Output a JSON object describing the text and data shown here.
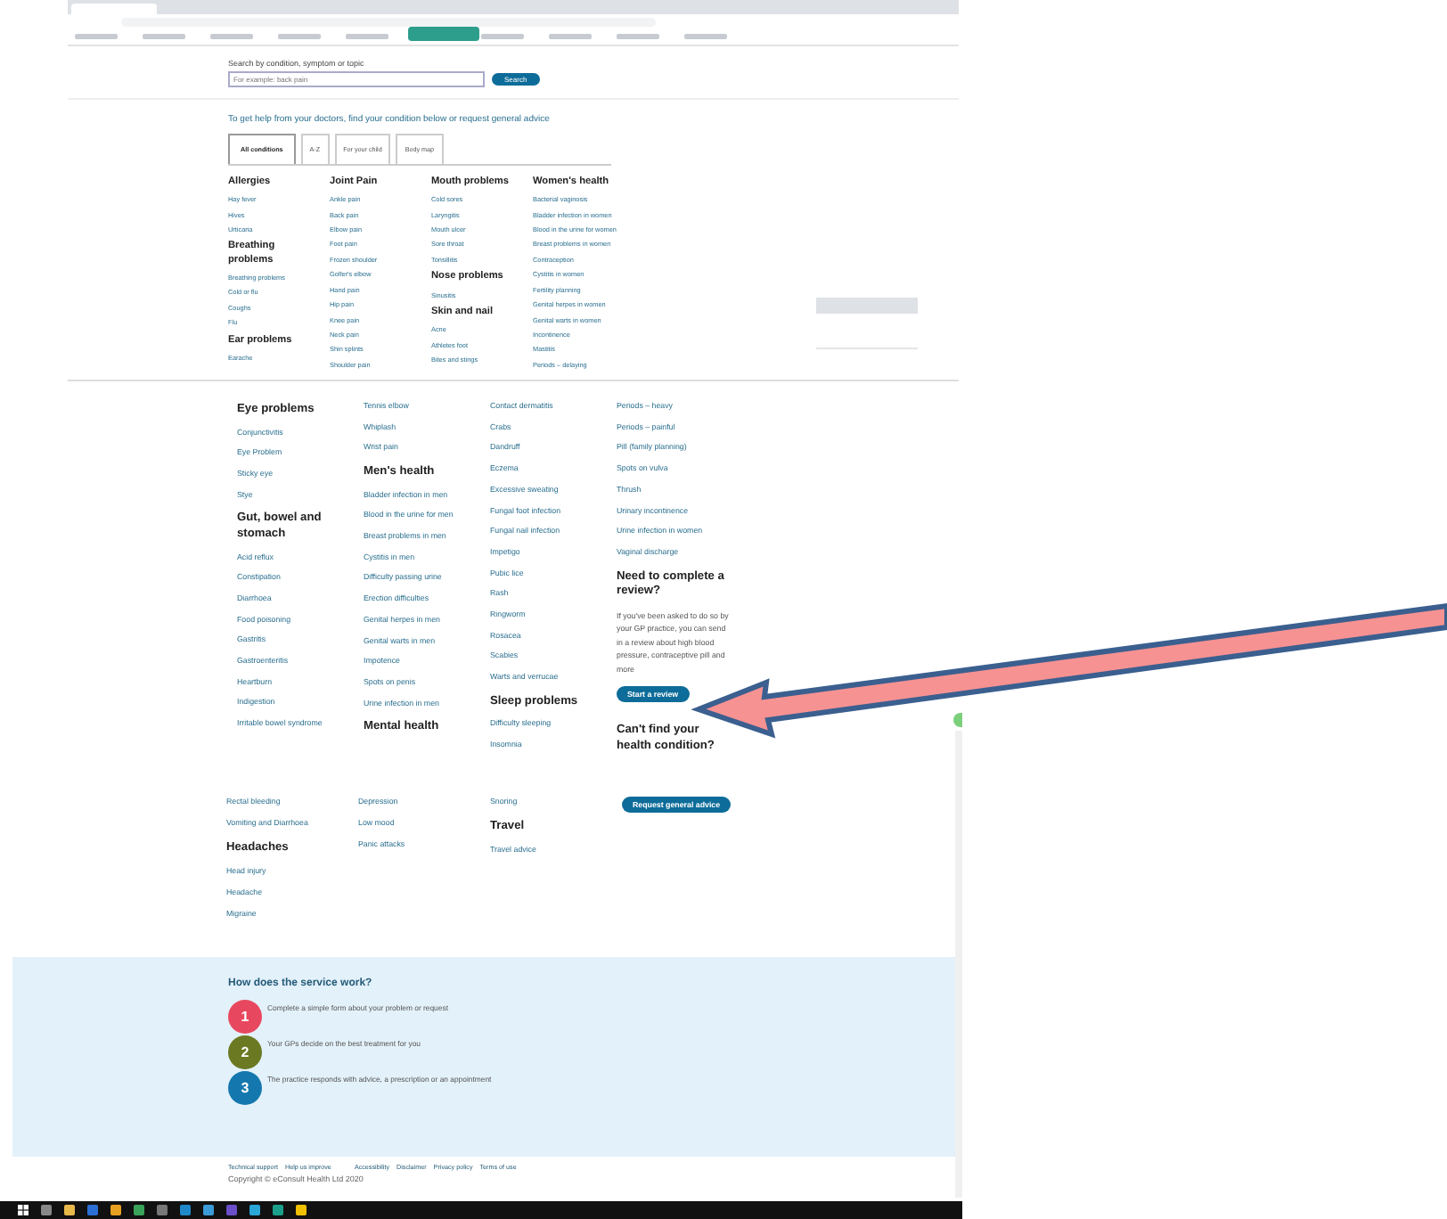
{
  "search": {
    "label": "Search by condition, symptom or topic",
    "placeholder": "For example: back pain",
    "button": "Search"
  },
  "intro": "To get help from your doctors, find your condition below or request general advice",
  "tabs": [
    {
      "label": "All conditions",
      "selected": true
    },
    {
      "label": "A-Z",
      "selected": false
    },
    {
      "label": "For your child",
      "selected": false
    },
    {
      "label": "Body map",
      "selected": false
    }
  ],
  "sections": [
    {
      "columns": [
        [
          {
            "kind": "heading",
            "text": "Allergies"
          },
          {
            "kind": "link",
            "text": "Hay fever"
          },
          {
            "kind": "link",
            "text": "Hives"
          },
          {
            "kind": "link",
            "text": "Urticaria"
          },
          {
            "kind": "heading",
            "text": "Breathing problems"
          },
          {
            "kind": "link",
            "text": "Breathing problems"
          },
          {
            "kind": "link",
            "text": "Cold or flu"
          },
          {
            "kind": "link",
            "text": "Coughs"
          },
          {
            "kind": "link",
            "text": "Flu"
          },
          {
            "kind": "heading",
            "text": "Ear problems"
          },
          {
            "kind": "link",
            "text": "Earache"
          }
        ],
        [
          {
            "kind": "heading",
            "text": "Joint Pain"
          },
          {
            "kind": "link",
            "text": "Ankle pain"
          },
          {
            "kind": "link",
            "text": "Back pain"
          },
          {
            "kind": "link",
            "text": "Elbow pain"
          },
          {
            "kind": "link",
            "text": "Foot pain"
          },
          {
            "kind": "link",
            "text": "Frozen shoulder"
          },
          {
            "kind": "link",
            "text": "Golfer's elbow"
          },
          {
            "kind": "link",
            "text": "Hand pain"
          },
          {
            "kind": "link",
            "text": "Hip pain"
          },
          {
            "kind": "link",
            "text": "Knee pain"
          },
          {
            "kind": "link",
            "text": "Neck pain"
          },
          {
            "kind": "link",
            "text": "Shin splints"
          },
          {
            "kind": "link",
            "text": "Shoulder pain"
          }
        ],
        [
          {
            "kind": "heading",
            "text": "Mouth problems"
          },
          {
            "kind": "link",
            "text": "Cold sores"
          },
          {
            "kind": "link",
            "text": "Laryngitis"
          },
          {
            "kind": "link",
            "text": "Mouth ulcer"
          },
          {
            "kind": "link",
            "text": "Sore throat"
          },
          {
            "kind": "link",
            "text": "Tonsillitis"
          },
          {
            "kind": "heading",
            "text": "Nose problems"
          },
          {
            "kind": "link",
            "text": "Sinusitis"
          },
          {
            "kind": "heading",
            "text": "Skin and nail"
          },
          {
            "kind": "link",
            "text": "Acne"
          },
          {
            "kind": "link",
            "text": "Athletes foot"
          },
          {
            "kind": "link",
            "text": "Bites and stings"
          }
        ],
        [
          {
            "kind": "heading",
            "text": "Women's health"
          },
          {
            "kind": "link",
            "text": "Bacterial vaginosis"
          },
          {
            "kind": "link",
            "text": "Bladder infection in women"
          },
          {
            "kind": "link",
            "text": "Blood in the urine for women"
          },
          {
            "kind": "link",
            "text": "Breast problems in women"
          },
          {
            "kind": "link",
            "text": "Contraception"
          },
          {
            "kind": "link",
            "text": "Cystitis in women"
          },
          {
            "kind": "link",
            "text": "Fertility planning"
          },
          {
            "kind": "link",
            "text": "Genital herpes in women"
          },
          {
            "kind": "link",
            "text": "Genital warts in women"
          },
          {
            "kind": "link",
            "text": "Incontinence"
          },
          {
            "kind": "link",
            "text": "Mastitis"
          },
          {
            "kind": "link",
            "text": "Periods – delaying"
          }
        ]
      ]
    },
    {
      "columns": [
        [
          {
            "kind": "heading",
            "text": "Eye problems"
          },
          {
            "kind": "link",
            "text": "Conjunctivitis"
          },
          {
            "kind": "link",
            "text": "Eye Problem"
          },
          {
            "kind": "link",
            "text": "Sticky eye"
          },
          {
            "kind": "link",
            "text": "Stye"
          },
          {
            "kind": "heading",
            "text": "Gut, bowel and stomach"
          },
          {
            "kind": "link",
            "text": "Acid reflux"
          },
          {
            "kind": "link",
            "text": "Constipation"
          },
          {
            "kind": "link",
            "text": "Diarrhoea"
          },
          {
            "kind": "link",
            "text": "Food poisoning"
          },
          {
            "kind": "link",
            "text": "Gastritis"
          },
          {
            "kind": "link",
            "text": "Gastroenteritis"
          },
          {
            "kind": "link",
            "text": "Heartburn"
          },
          {
            "kind": "link",
            "text": "Indigestion"
          },
          {
            "kind": "link",
            "text": "Irritable bowel syndrome"
          }
        ],
        [
          {
            "kind": "link",
            "text": "Tennis elbow"
          },
          {
            "kind": "link",
            "text": "Whiplash"
          },
          {
            "kind": "link",
            "text": "Wrist pain"
          },
          {
            "kind": "heading",
            "text": "Men's health"
          },
          {
            "kind": "link",
            "text": "Bladder infection in men"
          },
          {
            "kind": "link",
            "text": "Blood in the urine for men"
          },
          {
            "kind": "link",
            "text": "Breast problems in men"
          },
          {
            "kind": "link",
            "text": "Cystitis in men"
          },
          {
            "kind": "link",
            "text": "Difficulty passing urine"
          },
          {
            "kind": "link",
            "text": "Erection difficulties"
          },
          {
            "kind": "link",
            "text": "Genital herpes in men"
          },
          {
            "kind": "link",
            "text": "Genital warts in men"
          },
          {
            "kind": "link",
            "text": "Impotence"
          },
          {
            "kind": "link",
            "text": "Spots on penis"
          },
          {
            "kind": "link",
            "text": "Urine infection in men"
          },
          {
            "kind": "heading",
            "text": "Mental health"
          }
        ],
        [
          {
            "kind": "link",
            "text": "Contact dermatitis"
          },
          {
            "kind": "link",
            "text": "Crabs"
          },
          {
            "kind": "link",
            "text": "Dandruff"
          },
          {
            "kind": "link",
            "text": "Eczema"
          },
          {
            "kind": "link",
            "text": "Excessive sweating"
          },
          {
            "kind": "link",
            "text": "Fungal foot infection"
          },
          {
            "kind": "link",
            "text": "Fungal nail infection"
          },
          {
            "kind": "link",
            "text": "Impetigo"
          },
          {
            "kind": "link",
            "text": "Pubic lice"
          },
          {
            "kind": "link",
            "text": "Rash"
          },
          {
            "kind": "link",
            "text": "Ringworm"
          },
          {
            "kind": "link",
            "text": "Rosacea"
          },
          {
            "kind": "link",
            "text": "Scabies"
          },
          {
            "kind": "link",
            "text": "Warts and verrucae"
          },
          {
            "kind": "heading",
            "text": "Sleep problems"
          },
          {
            "kind": "link",
            "text": "Difficulty sleeping"
          },
          {
            "kind": "link",
            "text": "Insomnia"
          }
        ],
        [
          {
            "kind": "link",
            "text": "Periods – heavy"
          },
          {
            "kind": "link",
            "text": "Periods – painful"
          },
          {
            "kind": "link",
            "text": "Pill (family planning)"
          },
          {
            "kind": "link",
            "text": "Spots on vulva"
          },
          {
            "kind": "link",
            "text": "Thrush"
          },
          {
            "kind": "link",
            "text": "Urinary incontinence"
          },
          {
            "kind": "link",
            "text": "Urine infection in women"
          },
          {
            "kind": "link",
            "text": "Vaginal discharge"
          },
          {
            "kind": "heading",
            "text": "Need to complete a review?"
          },
          {
            "kind": "paragraph",
            "text": "If you've been asked to do so by your GP practice, you can send in a review about high blood pressure, contraceptive pill and more"
          },
          {
            "kind": "button",
            "text": "Start a review"
          },
          {
            "kind": "heading",
            "text": "Can't find your health condition?"
          }
        ]
      ]
    },
    {
      "columns": [
        [
          {
            "kind": "link",
            "text": "Rectal bleeding"
          },
          {
            "kind": "link",
            "text": "Vomiting and Diarrhoea"
          },
          {
            "kind": "heading",
            "text": "Headaches"
          },
          {
            "kind": "link",
            "text": "Head injury"
          },
          {
            "kind": "link",
            "text": "Headache"
          },
          {
            "kind": "link",
            "text": "Migraine"
          }
        ],
        [
          {
            "kind": "link",
            "text": "Depression"
          },
          {
            "kind": "link",
            "text": "Low mood"
          },
          {
            "kind": "link",
            "text": "Panic attacks"
          }
        ],
        [
          {
            "kind": "link",
            "text": "Snoring"
          },
          {
            "kind": "heading",
            "text": "Travel"
          },
          {
            "kind": "link",
            "text": "Travel advice"
          }
        ],
        [
          {
            "kind": "button",
            "text": "Request general advice"
          }
        ]
      ]
    }
  ],
  "service": {
    "title": "How does the service work?",
    "steps": [
      {
        "number": "1",
        "text": "Complete a simple form about your problem or request",
        "color": "#e8485f"
      },
      {
        "number": "2",
        "text": "Your GPs decide on the best treatment for you",
        "color": "#6b7a22"
      },
      {
        "number": "3",
        "text": "The practice responds with advice, a prescription or an appointment",
        "color": "#1478ae"
      }
    ]
  },
  "footer": {
    "links": [
      "Technical support",
      "Help us improve",
      "Accessibility",
      "Disclaimer",
      "Privacy policy",
      "Terms of use"
    ],
    "copyright": "Copyright © eConsult Health Ltd 2020"
  }
}
